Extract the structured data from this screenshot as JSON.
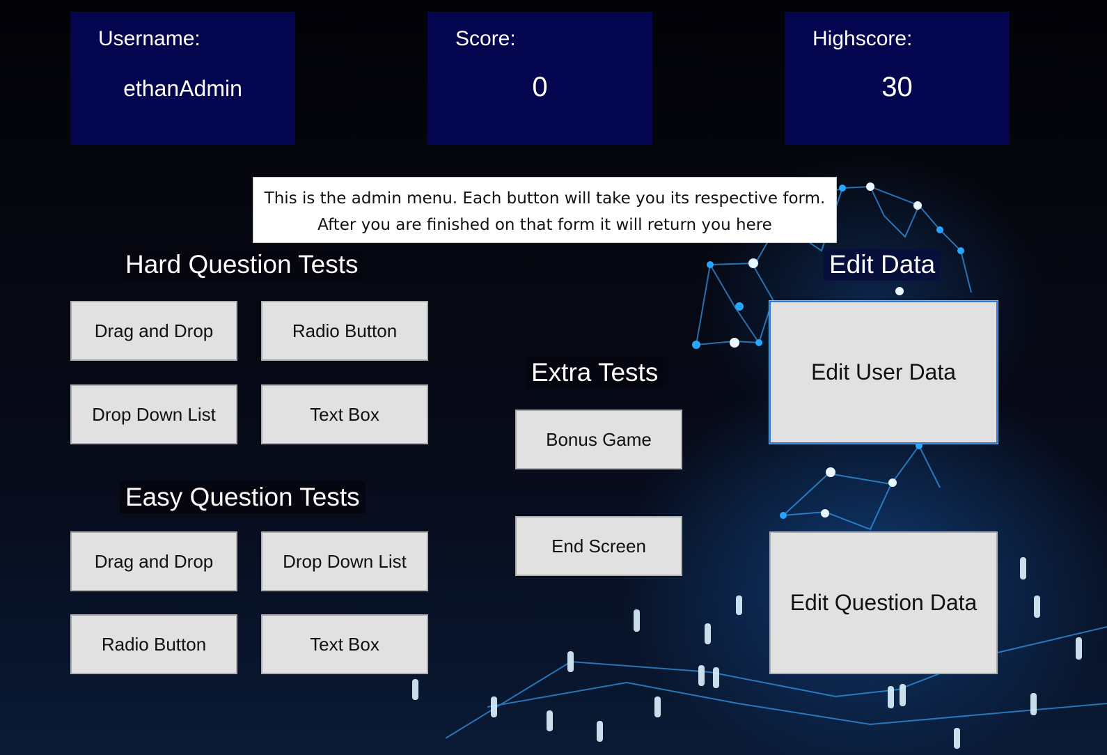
{
  "stats": {
    "username_label": "Username:",
    "username_value": "ethanAdmin",
    "score_label": "Score:",
    "score_value": "0",
    "highscore_label": "Highscore:",
    "highscore_value": "30"
  },
  "notice": {
    "line1": "This is the admin menu. Each button will take you its respective form.",
    "line2": "After you are finished on that form it will return you here"
  },
  "hard_tests": {
    "title": "Hard Question Tests",
    "drag_and_drop": "Drag and Drop",
    "radio_button": "Radio Button",
    "drop_down_list": "Drop Down List",
    "text_box": "Text Box"
  },
  "easy_tests": {
    "title": "Easy Question Tests",
    "drag_and_drop": "Drag and Drop",
    "drop_down_list": "Drop Down List",
    "radio_button": "Radio Button",
    "text_box": "Text Box"
  },
  "extra_tests": {
    "title": "Extra Tests",
    "bonus_game": "Bonus Game",
    "end_screen": "End Screen"
  },
  "edit_data": {
    "title": "Edit Data",
    "edit_user_data": "Edit User Data",
    "edit_question_data": "Edit Question Data"
  },
  "colors": {
    "stat_box": "#03064f",
    "button_face": "#e1e1e1",
    "focus_border": "#2b7cd9"
  }
}
